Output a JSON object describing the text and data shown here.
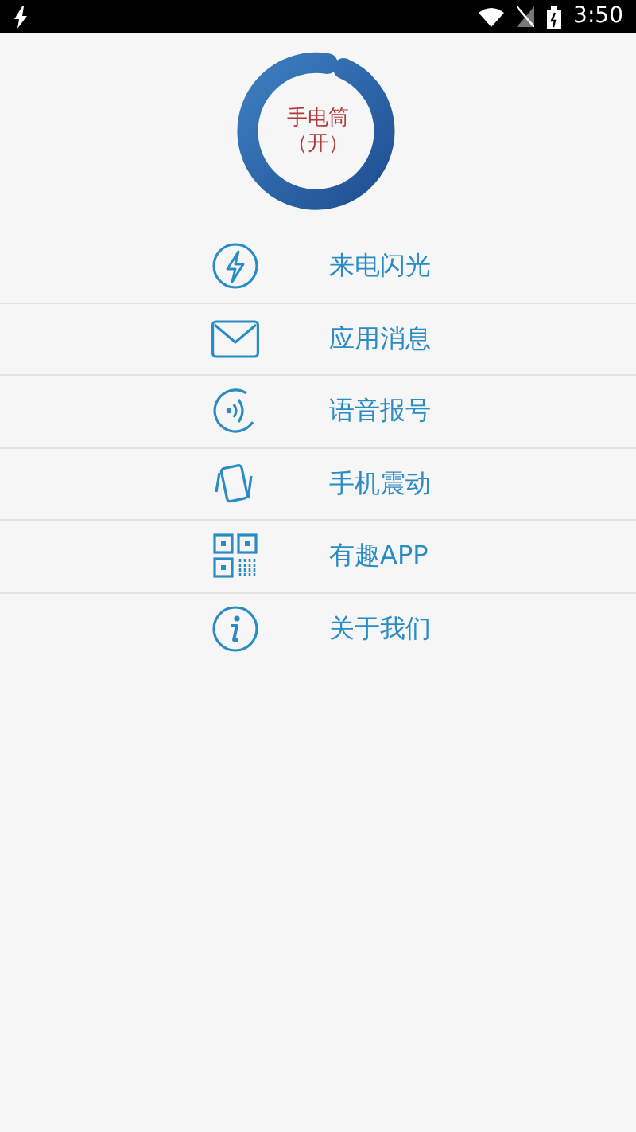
{
  "status_bar": {
    "time": "3:50"
  },
  "flashlight": {
    "title": "手电筒",
    "state_label": "（开）"
  },
  "menu": [
    {
      "kind": "flash",
      "label": "来电闪光"
    },
    {
      "kind": "mail",
      "label": "应用消息"
    },
    {
      "kind": "voice",
      "label": "语音报号"
    },
    {
      "kind": "vibrate",
      "label": "手机震动"
    },
    {
      "kind": "qr",
      "label": "有趣APP"
    },
    {
      "kind": "info",
      "label": "关于我们"
    }
  ]
}
